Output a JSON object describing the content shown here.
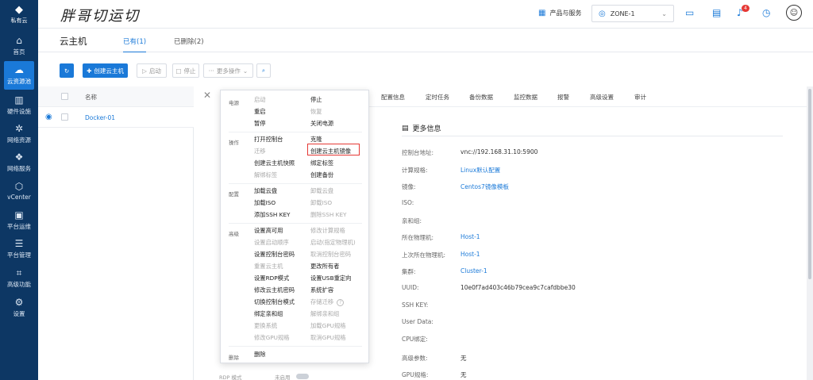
{
  "sidebar": {
    "logo_label": "私有云",
    "items": [
      {
        "label": "首页",
        "icon": "home-icon"
      },
      {
        "label": "云资源池",
        "icon": "cloud-icon"
      },
      {
        "label": "硬件设施",
        "icon": "building-icon"
      },
      {
        "label": "网络资源",
        "icon": "network-icon"
      },
      {
        "label": "网络服务",
        "icon": "network-service-icon"
      },
      {
        "label": "vCenter",
        "icon": "cube-icon"
      },
      {
        "label": "平台运维",
        "icon": "monitor-icon"
      },
      {
        "label": "平台管理",
        "icon": "list-icon"
      },
      {
        "label": "高级功能",
        "icon": "advanced-icon"
      },
      {
        "label": "设置",
        "icon": "gear-icon"
      }
    ],
    "active_index": 1
  },
  "topbar": {
    "brand": "胖哥切运切",
    "products_label": "产品与服务",
    "zone": "ZONE-1",
    "notification_count": "4"
  },
  "header": {
    "title": "云主机",
    "tabs": [
      "已有(1)",
      "已删除(2)"
    ]
  },
  "toolbar": {
    "create_label": "创建云主机",
    "start_label": "启动",
    "stop_label": "停止",
    "more_label": "更多操作"
  },
  "list": {
    "column_name": "名称",
    "rows": [
      {
        "name": "Docker-01"
      }
    ]
  },
  "detail": {
    "tabs": [
      "配置信息",
      "定时任务",
      "备份数据",
      "监控数据",
      "报警",
      "高级设置",
      "审计"
    ],
    "section_title": "更多信息",
    "fields": [
      {
        "key": "控制台地址:",
        "value": "vnc://192.168.31.10:5900",
        "link": false
      },
      {
        "key": "计算规格:",
        "value": "Linux默认配置",
        "link": true
      },
      {
        "key": "镜像:",
        "value": "Centos7镜像模板",
        "link": true
      },
      {
        "key": "ISO:",
        "value": "",
        "link": false
      },
      {
        "key": "亲和组:",
        "value": "",
        "link": false
      },
      {
        "key": "所在物理机:",
        "value": "Host-1",
        "link": true
      },
      {
        "key": "上次所在物理机:",
        "value": "Host-1",
        "link": true
      },
      {
        "key": "集群:",
        "value": "Cluster-1",
        "link": true
      },
      {
        "key": "UUID:",
        "value": "10e0f7ad403c46b79cea9c7cafdbbe30",
        "link": false
      },
      {
        "key": "SSH KEY:",
        "value": "",
        "link": false
      },
      {
        "key": "User Data:",
        "value": "",
        "link": false
      },
      {
        "key": "CPU绑定:",
        "value": "",
        "link": false
      },
      {
        "key": "高级参数:",
        "value": "无",
        "link": false
      },
      {
        "key": "GPU规格:",
        "value": "无",
        "link": false
      }
    ]
  },
  "menu": {
    "groups": {
      "power": "电源",
      "ops": "操作",
      "config": "配置",
      "advanced": "高级",
      "delete": "删除"
    },
    "items": {
      "start": "启动",
      "stop": "停止",
      "reboot": "重启",
      "resume": "恢复",
      "pause": "暂停",
      "power_off": "关闭电源",
      "open_console": "打开控制台",
      "clone": "克隆",
      "migrate": "迁移",
      "create_image": "创建云主机镜像",
      "create_snapshot": "创建云主机快照",
      "bind_tag": "绑定标签",
      "unbind_tag": "解绑标签",
      "create_backup": "创建备份",
      "attach_volume": "加载云盘",
      "detach_volume": "卸载云盘",
      "attach_iso": "加载ISO",
      "detach_iso": "卸载ISO",
      "add_ssh": "添加SSH KEY",
      "delete_ssh": "删除SSH KEY",
      "set_ha": "设置高可用",
      "modify_spec": "修改计算规格",
      "set_boot_order": "设置启动顺序",
      "boot_on_host": "启动(指定物理机)",
      "set_console_pwd": "设置控制台密码",
      "cancel_console_pwd": "取消控制台密码",
      "reset_vm": "重置云主机",
      "change_owner": "更改所有者",
      "set_rdp": "设置RDP模式",
      "set_usb": "设置USB重定向",
      "modify_vm_pwd": "修改云主机密码",
      "expand_system": "系统扩容",
      "switch_console": "切换控制台模式",
      "storage_migrate": "存储迁移",
      "bind_affinity": "绑定亲和组",
      "unbind_affinity": "解绑亲和组",
      "change_system": "更换系统",
      "load_gpu": "加载GPU规格",
      "modify_gpu": "修改GPU规格",
      "cancel_gpu": "取消GPU规格",
      "delete": "删除"
    }
  },
  "behind": {
    "rdp_label": "RDP 模式",
    "off_label": "未启用"
  },
  "colors": {
    "sidebar": "#0d3764",
    "accent": "#1a79d8",
    "highlight": "#e53935"
  }
}
